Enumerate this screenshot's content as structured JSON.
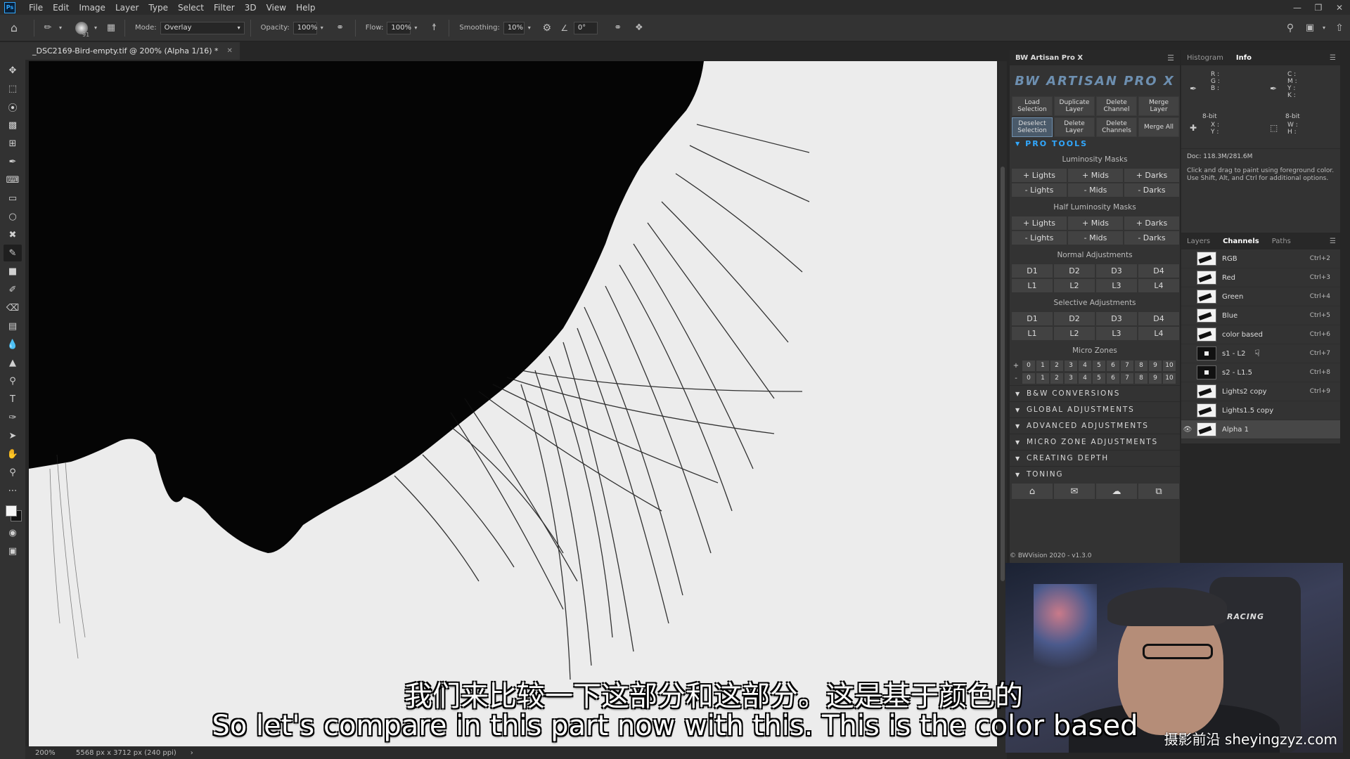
{
  "app": {
    "logo": "Ps"
  },
  "menu": [
    "File",
    "Edit",
    "Image",
    "Layer",
    "Type",
    "Select",
    "Filter",
    "3D",
    "View",
    "Help"
  ],
  "options": {
    "brush_size": "91",
    "mode_label": "Mode:",
    "mode_value": "Overlay",
    "opacity_label": "Opacity:",
    "opacity_value": "100%",
    "flow_label": "Flow:",
    "flow_value": "100%",
    "smoothing_label": "Smoothing:",
    "smoothing_value": "10%",
    "angle_value": "0°"
  },
  "document": {
    "tab_title": "_DSC2169-Bird-empty.tif @ 200% (Alpha 1/16) *",
    "zoom": "200%",
    "info": "5568 px x 3712 px (240 ppi)"
  },
  "bw": {
    "title": "BW Artisan Pro X",
    "logo_text": "BW ARTISAN PRO X",
    "buttons_row1": [
      "Load Selection",
      "Duplicate Layer",
      "Delete Channel",
      "Merge Layer"
    ],
    "buttons_row2": [
      "Deselect Selection",
      "Delete Layer",
      "Delete Channels",
      "Merge All"
    ],
    "pro_tools": "PRO TOOLS",
    "lum_title": "Luminosity Masks",
    "lum_plus": [
      "+ Lights",
      "+ Mids",
      "+ Darks"
    ],
    "lum_minus": [
      "- Lights",
      "- Mids",
      "- Darks"
    ],
    "half_title": "Half Luminosity Masks",
    "half_plus": [
      "+ Lights",
      "+ Mids",
      "+ Darks"
    ],
    "half_minus": [
      "- Lights",
      "- Mids",
      "- Darks"
    ],
    "normal_title": "Normal Adjustments",
    "normal_d": [
      "D1",
      "D2",
      "D3",
      "D4"
    ],
    "normal_l": [
      "L1",
      "L2",
      "L3",
      "L4"
    ],
    "selective_title": "Selective Adjustments",
    "sel_d": [
      "D1",
      "D2",
      "D3",
      "D4"
    ],
    "sel_l": [
      "L1",
      "L2",
      "L3",
      "L4"
    ],
    "micro_title": "Micro Zones",
    "micro_plus_sign": "+",
    "micro_minus_sign": "-",
    "micro_cells": [
      "0",
      "1",
      "2",
      "3",
      "4",
      "5",
      "6",
      "7",
      "8",
      "9",
      "10"
    ],
    "sections": [
      "B&W CONVERSIONS",
      "GLOBAL ADJUSTMENTS",
      "ADVANCED ADJUSTMENTS",
      "MICRO ZONE ADJUSTMENTS",
      "CREATING DEPTH",
      "TONING"
    ],
    "copyright": "© BWVision 2020 - v1.3.0"
  },
  "info_panel": {
    "tabs": [
      "Histogram",
      "Info"
    ],
    "rgb_labels": [
      "R :",
      "G :",
      "B :"
    ],
    "cmyk_labels": [
      "C :",
      "M :",
      "Y :",
      "K :"
    ],
    "bit_left": "8-bit",
    "bit_right": "8-bit",
    "xy_labels": [
      "X :",
      "Y :"
    ],
    "wh_labels": [
      "W :",
      "H :"
    ],
    "doc": "Doc: 118.3M/281.6M",
    "hint": "Click and drag to paint using foreground color. Use Shift, Alt, and Ctrl for additional options."
  },
  "channels_panel": {
    "tabs": [
      "Layers",
      "Channels",
      "Paths"
    ],
    "rows": [
      {
        "name": "RGB",
        "shortcut": "Ctrl+2"
      },
      {
        "name": "Red",
        "shortcut": "Ctrl+3"
      },
      {
        "name": "Green",
        "shortcut": "Ctrl+4"
      },
      {
        "name": "Blue",
        "shortcut": "Ctrl+5"
      },
      {
        "name": "color based",
        "shortcut": "Ctrl+6"
      },
      {
        "name": "s1 - L2",
        "shortcut": "Ctrl+7"
      },
      {
        "name": "s2 - L1.5",
        "shortcut": "Ctrl+8"
      },
      {
        "name": "Lights2 copy",
        "shortcut": "Ctrl+9"
      },
      {
        "name": "Lights1.5 copy",
        "shortcut": ""
      },
      {
        "name": "Alpha 1",
        "shortcut": ""
      }
    ]
  },
  "webcam": {
    "chair_text": "RACING",
    "watermark": "摄影前沿 sheyingzyz.com"
  },
  "subtitles": {
    "cn": "我们来比较一下这部分和这部分。这是基于颜色的",
    "en": "So let's compare in this part now with this. This is the color based"
  }
}
